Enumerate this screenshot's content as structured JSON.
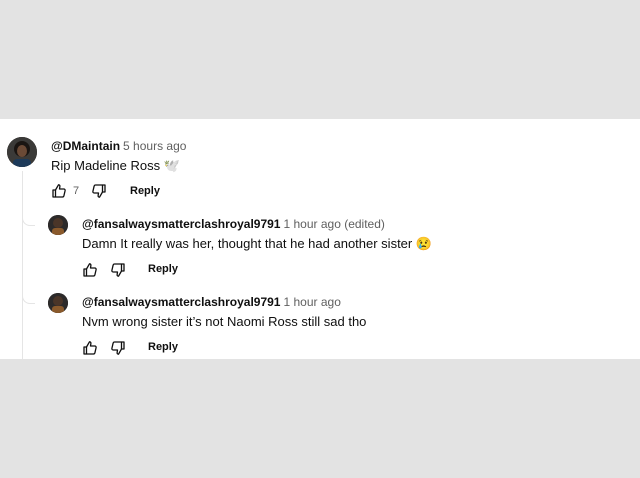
{
  "comments": [
    {
      "handle": "@DMaintain",
      "time": "5 hours ago",
      "text": "Rip Madeline Ross 🕊️",
      "likes": "7",
      "reply_label": "Reply"
    }
  ],
  "replies": [
    {
      "handle": "@fansalwaysmatterclashroyal9791",
      "time": "1 hour ago (edited)",
      "text": "Damn It really was her, thought that he had another sister 😢",
      "reply_label": "Reply"
    },
    {
      "handle": "@fansalwaysmatterclashroyal9791",
      "time": "1 hour ago",
      "text": "Nvm wrong sister it’s not Naomi Ross still sad tho",
      "reply_label": "Reply"
    }
  ],
  "icons": {
    "like": "thumbs-up-icon",
    "dislike": "thumbs-down-icon"
  },
  "colors": {
    "backdrop": "#e3e3e3",
    "panel": "#ffffff",
    "meta_gray": "#606060"
  }
}
